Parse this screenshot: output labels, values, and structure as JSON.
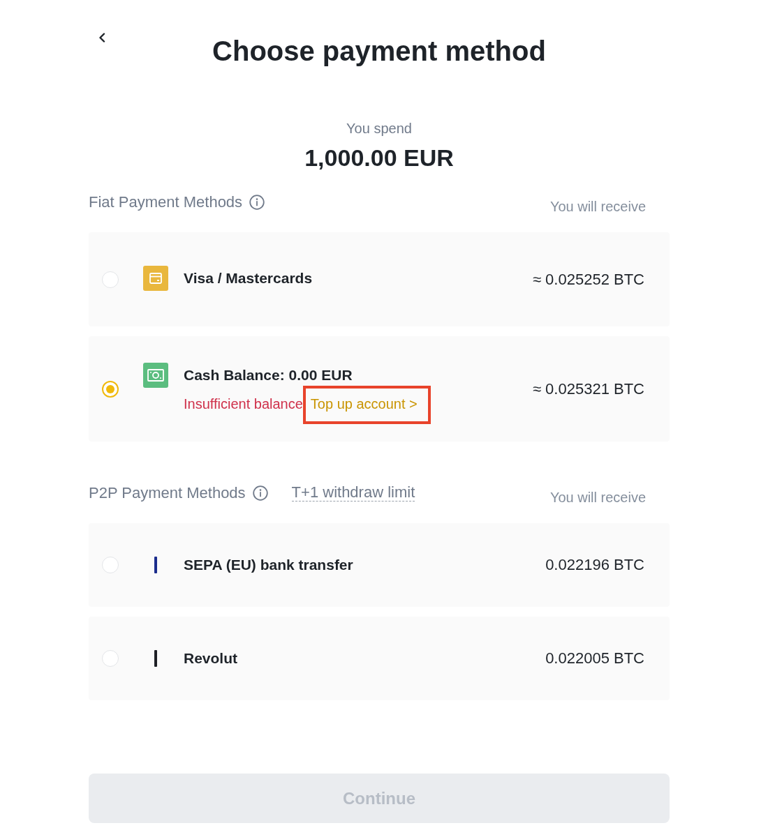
{
  "title": "Choose payment method",
  "spend": {
    "label": "You spend",
    "amount": "1,000.00 EUR"
  },
  "sections": [
    {
      "title": "Fiat Payment Methods",
      "receive_label": "You will receive",
      "methods": [
        {
          "kind": "card",
          "name": "Visa / Mastercards",
          "amount": "≈ 0.025252 BTC",
          "selected": false
        },
        {
          "kind": "cash",
          "name": "Cash Balance: 0.00 EUR",
          "warning": "Insufficient balance",
          "link": {
            "text": "Top up account >",
            "highlighted": true
          },
          "amount": "≈ 0.025321 BTC",
          "selected": true
        }
      ]
    },
    {
      "title": "P2P Payment Methods",
      "note": "T+1 withdraw limit",
      "receive_label": "You will receive",
      "methods": [
        {
          "kind": "bar",
          "color": "#1b2c8c",
          "name": "SEPA (EU) bank transfer",
          "amount": "0.022196 BTC",
          "selected": false
        },
        {
          "kind": "bar",
          "color": "#1e2026",
          "name": "Revolut",
          "amount": "0.022005 BTC",
          "selected": false
        }
      ]
    }
  ],
  "continue_button": {
    "label": "Continue",
    "disabled": true
  }
}
